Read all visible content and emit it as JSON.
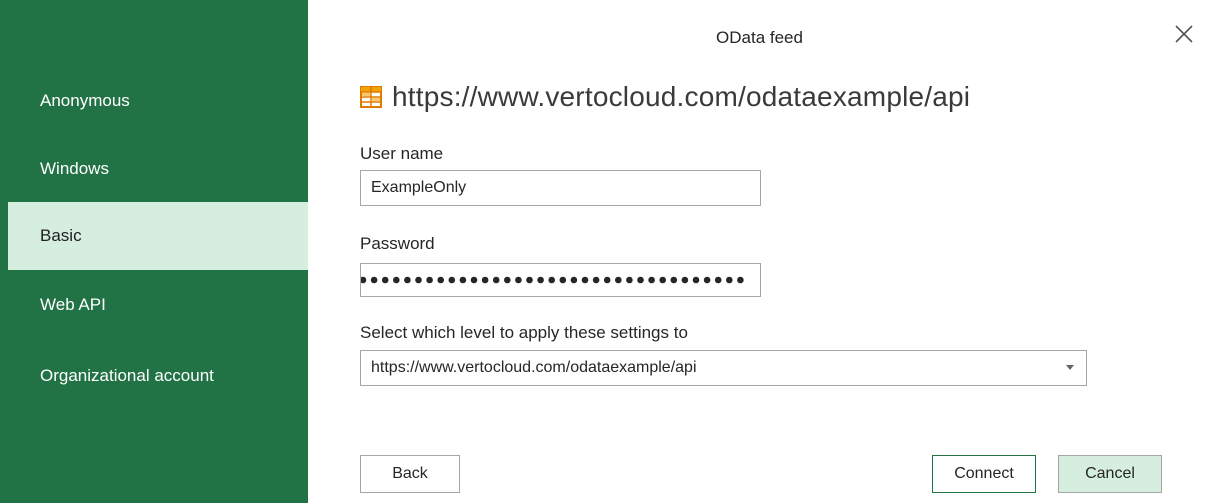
{
  "dialog": {
    "title": "OData feed"
  },
  "sidebar": {
    "items": [
      {
        "label": "Anonymous",
        "selected": false
      },
      {
        "label": "Windows",
        "selected": false
      },
      {
        "label": "Basic",
        "selected": true
      },
      {
        "label": "Web API",
        "selected": false
      },
      {
        "label": "Organizational account",
        "selected": false
      }
    ]
  },
  "feed": {
    "url": "https://www.vertocloud.com/odataexample/api",
    "icon": "table-feed-icon"
  },
  "form": {
    "username_label": "User name",
    "username_value": "ExampleOnly",
    "password_label": "Password",
    "password_masked": "●●●●●●●●●●●●●●●●●●●●●●●●●●●●●●●●●●●",
    "level_label": "Select which level to apply these settings to",
    "level_selected": "https://www.vertocloud.com/odataexample/api"
  },
  "buttons": {
    "back": "Back",
    "connect": "Connect",
    "cancel": "Cancel"
  },
  "colors": {
    "sidebar_bg": "#217346",
    "selected_bg": "#d5eedf",
    "icon_orange": "#f0a30a"
  }
}
